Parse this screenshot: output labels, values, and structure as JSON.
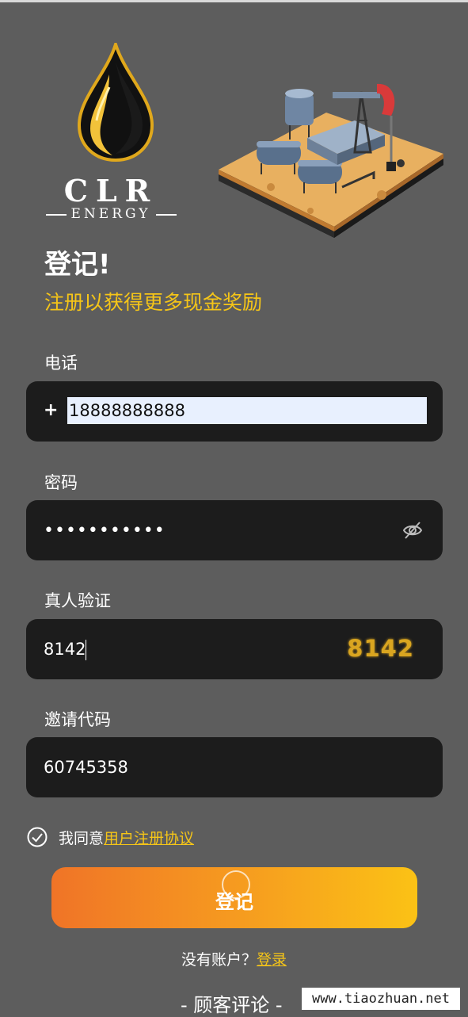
{
  "brand": {
    "name": "CLR",
    "tagline": "ENERGY"
  },
  "heading": "登记!",
  "subheading": "注册以获得更多现金奖励",
  "phone": {
    "label": "电话",
    "prefix": "+",
    "value": "18888888888"
  },
  "password": {
    "label": "密码",
    "value": "•••••••••••"
  },
  "captcha": {
    "label": "真人验证",
    "value": "8142",
    "code": "8142"
  },
  "invite": {
    "label": "邀请代码",
    "value": "60745358"
  },
  "agreement": {
    "text": "我同意",
    "link": "用户注册协议"
  },
  "submit": {
    "label": "登记"
  },
  "login_prompt": {
    "text": "没有账户？",
    "link": "登录"
  },
  "reviews": "- 顾客评论 -",
  "watermark": "www.tiaozhuan.net",
  "colors": {
    "accent": "#f5c518",
    "background": "#5d5d5d",
    "field": "#1c1c1c",
    "gradient_start": "#f07427",
    "gradient_end": "#fbc215"
  }
}
